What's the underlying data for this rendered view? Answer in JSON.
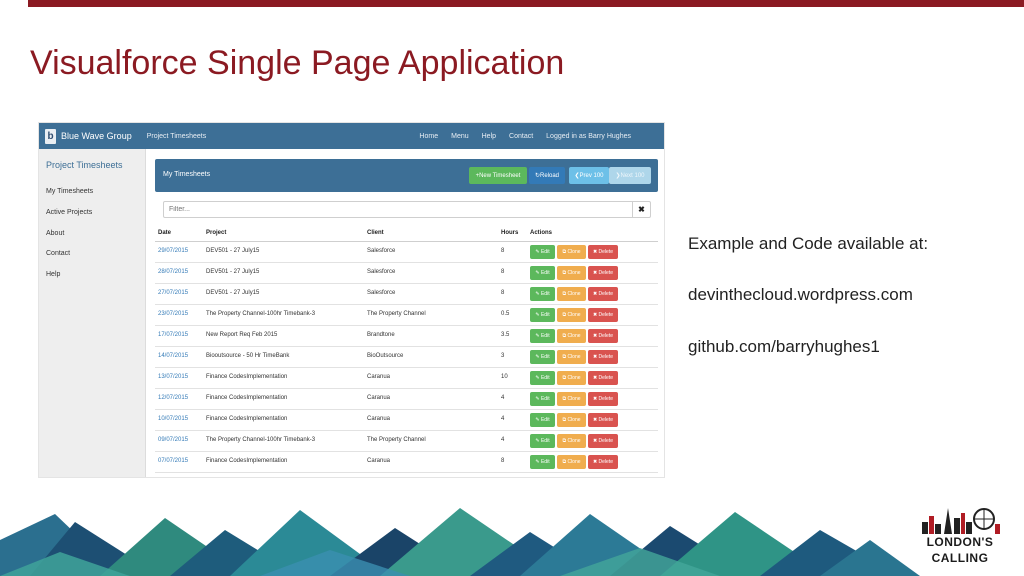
{
  "slide": {
    "title": "Visualforce Single Page Application",
    "info_lines": [
      "Example and Code available at:",
      "devinthecloud.wordpress.com",
      "github.com/barryhughes1"
    ],
    "accent_color": "#8b1a22"
  },
  "app": {
    "brand_logo_letter": "b",
    "brand_name": "Blue Wave Group",
    "nav_left": "Project Timesheets",
    "nav_right": [
      "Home",
      "Menu",
      "Help",
      "Contact",
      "Logged in as Barry Hughes"
    ],
    "sidebar": {
      "title": "Project Timesheets",
      "items": [
        "My Timesheets",
        "Active Projects",
        "About",
        "Contact",
        "Help"
      ]
    },
    "panel": {
      "title": "My Timesheets",
      "new_button": "+New Timesheet",
      "reload_button": "↻Reload",
      "prev_button": "❮Prev 100",
      "next_button": "❯Next 100"
    },
    "filter": {
      "placeholder": "Filter...",
      "clear_icon": "✖"
    },
    "table": {
      "headers": {
        "date": "Date",
        "project": "Project",
        "client": "Client",
        "hours": "Hours",
        "actions": "Actions"
      },
      "action_labels": {
        "edit": "✎ Edit",
        "clone": "⧉ Clone",
        "delete": "✖ Delete"
      },
      "rows": [
        {
          "date": "29/07/2015",
          "project": "DEV501 - 27 July15",
          "client": "Salesforce",
          "hours": "8"
        },
        {
          "date": "28/07/2015",
          "project": "DEV501 - 27 July15",
          "client": "Salesforce",
          "hours": "8"
        },
        {
          "date": "27/07/2015",
          "project": "DEV501 - 27 July15",
          "client": "Salesforce",
          "hours": "8"
        },
        {
          "date": "23/07/2015",
          "project": "The Property Channel-100hr Timebank-3",
          "client": "The Property Channel",
          "hours": "0.5"
        },
        {
          "date": "17/07/2015",
          "project": "New Report Req Feb 2015",
          "client": "Brandtone",
          "hours": "3.5"
        },
        {
          "date": "14/07/2015",
          "project": "Biooutsource - 50 Hr TimeBank",
          "client": "BioOutsource",
          "hours": "3"
        },
        {
          "date": "13/07/2015",
          "project": "Finance CodesImplementation",
          "client": "Caranua",
          "hours": "10"
        },
        {
          "date": "12/07/2015",
          "project": "Finance CodesImplementation",
          "client": "Caranua",
          "hours": "4"
        },
        {
          "date": "10/07/2015",
          "project": "Finance CodesImplementation",
          "client": "Caranua",
          "hours": "4"
        },
        {
          "date": "09/07/2015",
          "project": "The Property Channel-100hr Timebank-3",
          "client": "The Property Channel",
          "hours": "4"
        },
        {
          "date": "07/07/2015",
          "project": "Finance CodesImplementation",
          "client": "Caranua",
          "hours": "8"
        }
      ]
    }
  },
  "logo": {
    "line1": "LONDON'S",
    "line2": "CALLING"
  }
}
